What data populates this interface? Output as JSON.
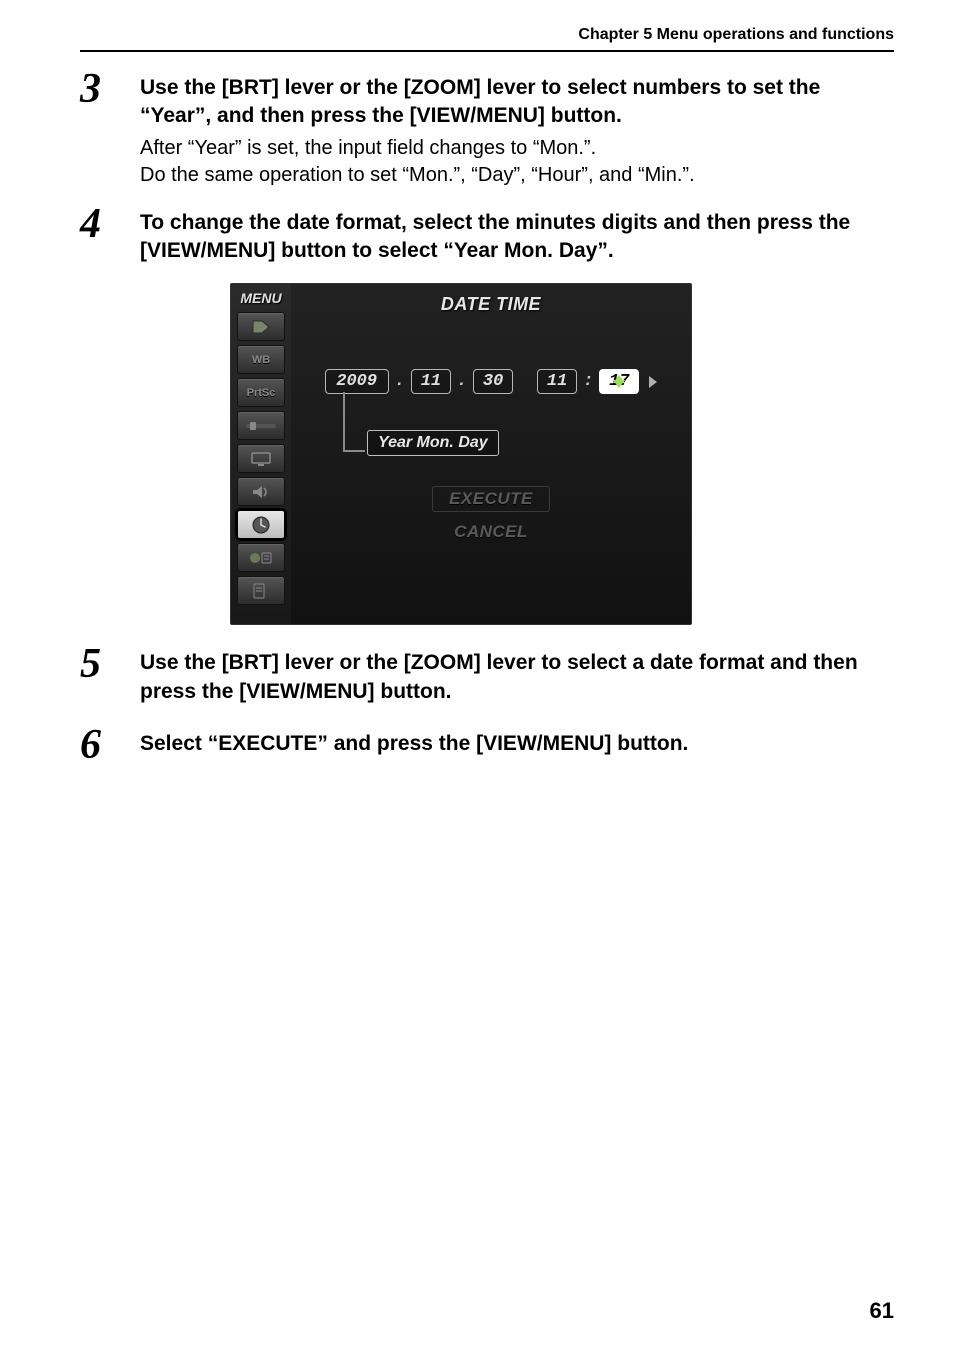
{
  "chapter_header": "Chapter 5 Menu operations and functions",
  "page_number": "61",
  "steps": [
    {
      "num": "3",
      "title": "Use the [BRT] lever or the [ZOOM] lever to select numbers to set the “Year”, and then press the [VIEW/MENU] button.",
      "desc_lines": [
        "After “Year” is set, the input field changes to “Mon.”.",
        "Do the same operation to set “Mon.”, “Day”, “Hour”, and “Min.”."
      ]
    },
    {
      "num": "4",
      "title": "To change the date format, select the minutes digits and then press the [VIEW/MENU] button to select “Year  Mon. Day”."
    },
    {
      "num": "5",
      "title": "Use the [BRT] lever or the [ZOOM] lever to select a date format and then press the [VIEW/MENU] button."
    },
    {
      "num": "6",
      "title": "Select “EXECUTE” and press the [VIEW/MENU] button."
    }
  ],
  "menu": {
    "side_label": "MENU",
    "title": "DATE TIME",
    "date": {
      "year": "2009",
      "mon": "11",
      "day": "30",
      "hour": "11",
      "min": "17"
    },
    "format_label": "Year   Mon. Day",
    "execute_label": "EXECUTE",
    "cancel_label": "CANCEL",
    "side_icons": {
      "wb": "WB",
      "prtsc": "PrtSc"
    }
  }
}
